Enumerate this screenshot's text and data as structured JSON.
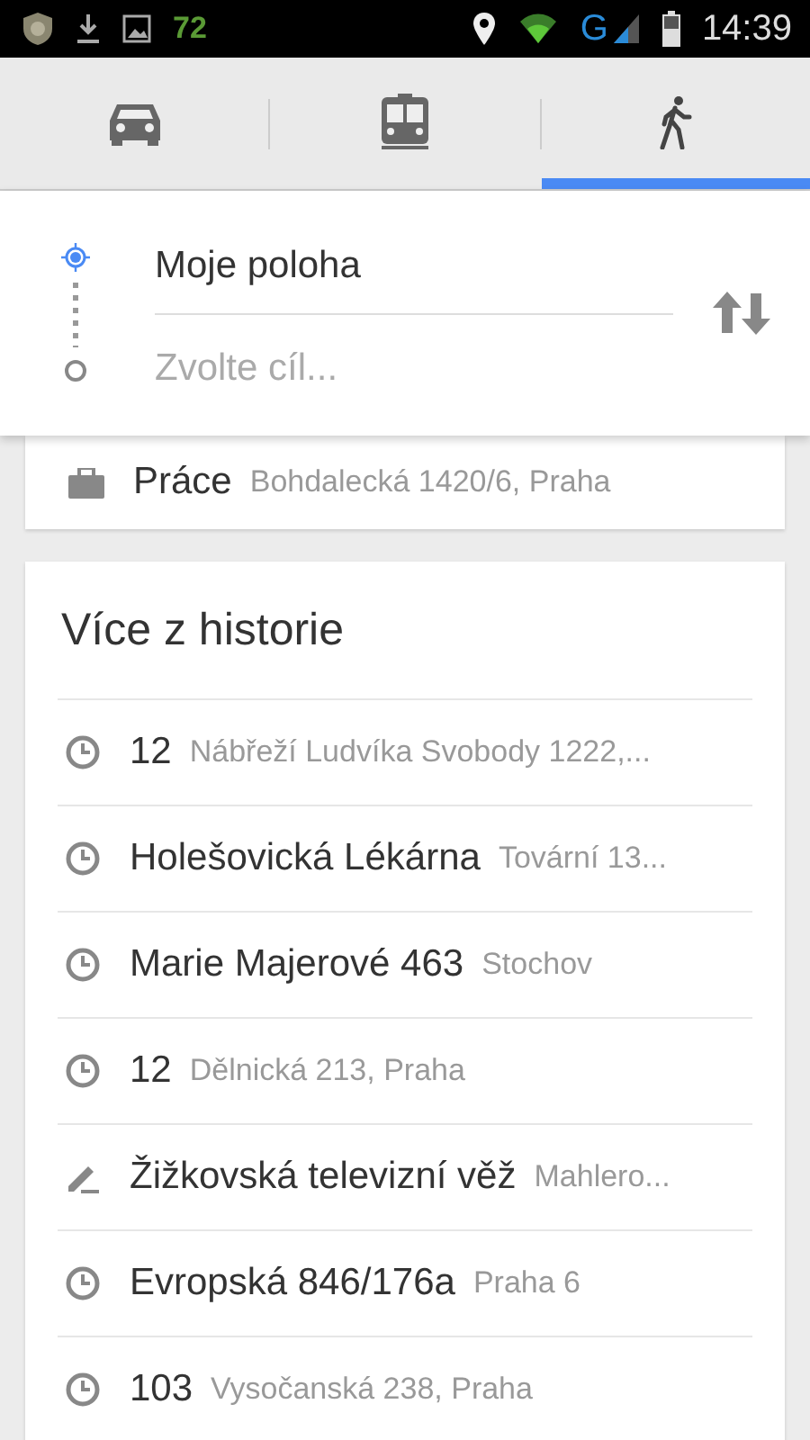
{
  "status_bar": {
    "notification_count": "72",
    "network": "G",
    "time": "14:39"
  },
  "tabs": [
    {
      "kind": "car",
      "selected": false
    },
    {
      "kind": "transit",
      "selected": false
    },
    {
      "kind": "walk",
      "selected": true
    }
  ],
  "route": {
    "origin": "Moje poloha",
    "destination_placeholder": "Zvolte cíl..."
  },
  "saved_place": {
    "name": "Práce",
    "address": "Bohdalecká 1420/6, Praha"
  },
  "history": {
    "title": "Více z historie",
    "items": [
      {
        "kind": "recent",
        "name": "12",
        "address": "Nábřeží Ludvíka Svobody 1222,..."
      },
      {
        "kind": "recent",
        "name": "Holešovická Lékárna",
        "address": "Tovární 13..."
      },
      {
        "kind": "recent",
        "name": "Marie Majerové 463",
        "address": "Stochov"
      },
      {
        "kind": "recent",
        "name": "12",
        "address": "Dělnická 213, Praha"
      },
      {
        "kind": "edited",
        "name": "Žižkovská televizní věž",
        "address": "Mahlero..."
      },
      {
        "kind": "recent",
        "name": "Evropská 846/176a",
        "address": "Praha 6"
      },
      {
        "kind": "recent",
        "name": "103",
        "address": "Vysočanská 238, Praha"
      }
    ]
  }
}
